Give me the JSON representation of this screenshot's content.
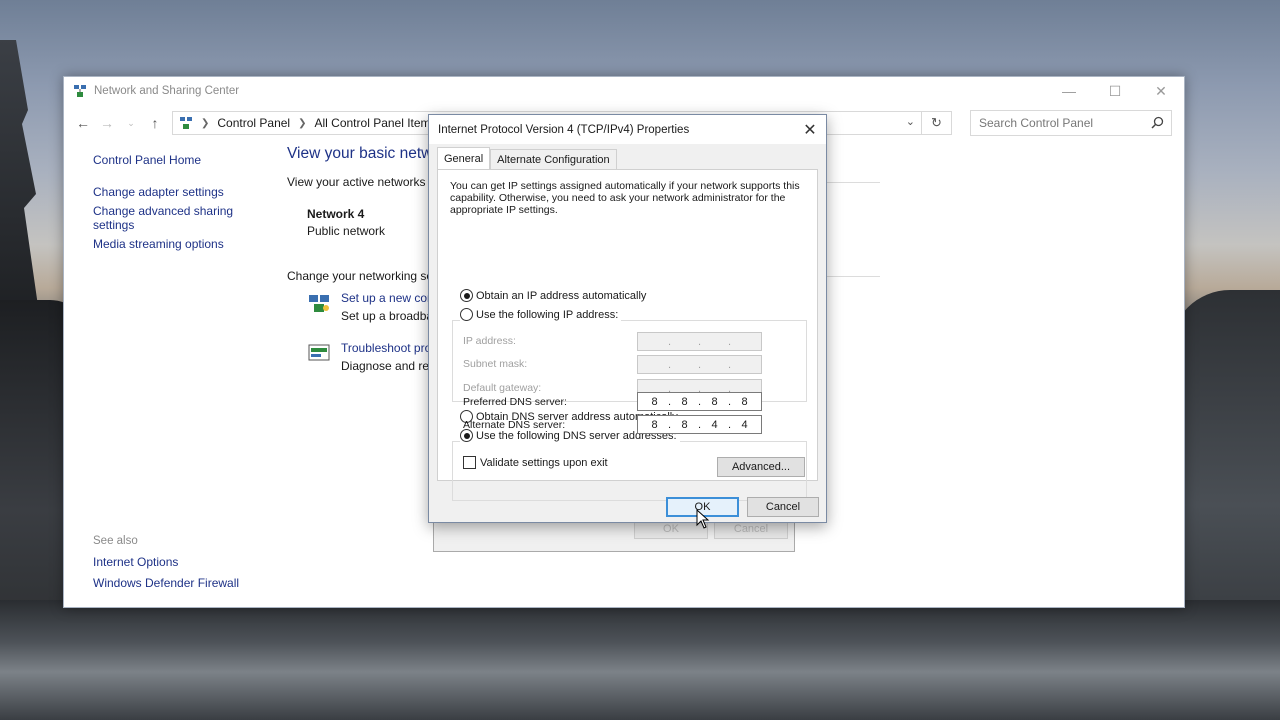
{
  "cp_window": {
    "title": "Network and Sharing Center",
    "breadcrumbs": [
      "Control Panel",
      "All Control Panel Items"
    ],
    "search_placeholder": "Search Control Panel",
    "sidebar": {
      "home": "Control Panel Home",
      "links": [
        "Change adapter settings",
        "Change advanced sharing settings",
        "Media streaming options"
      ]
    },
    "see_also": {
      "header": "See also",
      "links": [
        "Internet Options",
        "Windows Defender Firewall"
      ]
    },
    "main": {
      "heading": "View your basic netw",
      "active_networks_label": "View your active networks",
      "network_name": "Network 4",
      "network_type": "Public network",
      "change_header": "Change your networking se",
      "tasks": [
        {
          "link": "Set up a new con",
          "desc": "Set up a broadba"
        },
        {
          "link": "Troubleshoot pro",
          "desc": "Diagnose and rep"
        }
      ]
    }
  },
  "ghost_dialog": {
    "ok": "OK",
    "cancel": "Cancel"
  },
  "dialog": {
    "title": "Internet Protocol Version 4 (TCP/IPv4) Properties",
    "tabs": [
      "General",
      "Alternate Configuration"
    ],
    "intro": "You can get IP settings assigned automatically if your network supports this capability. Otherwise, you need to ask your network administrator for the appropriate IP settings.",
    "ip_auto": {
      "label": "Obtain an IP address automatically",
      "selected": true
    },
    "ip_manual": {
      "label": "Use the following IP address:",
      "selected": false
    },
    "ip_fields": {
      "ip_address": "IP address:",
      "subnet_mask": "Subnet mask:",
      "default_gateway": "Default gateway:"
    },
    "dns_auto": {
      "label": "Obtain DNS server address automatically",
      "selected": false
    },
    "dns_manual": {
      "label": "Use the following DNS server addresses:",
      "selected": true
    },
    "dns_fields": {
      "preferred_label": "Preferred DNS server:",
      "preferred": [
        "8",
        "8",
        "8",
        "8"
      ],
      "alternate_label": "Alternate DNS server:",
      "alternate": [
        "8",
        "8",
        "4",
        "4"
      ]
    },
    "validate": {
      "label": "Validate settings upon exit",
      "checked": false
    },
    "advanced": "Advanced...",
    "ok": "OK",
    "cancel": "Cancel"
  }
}
